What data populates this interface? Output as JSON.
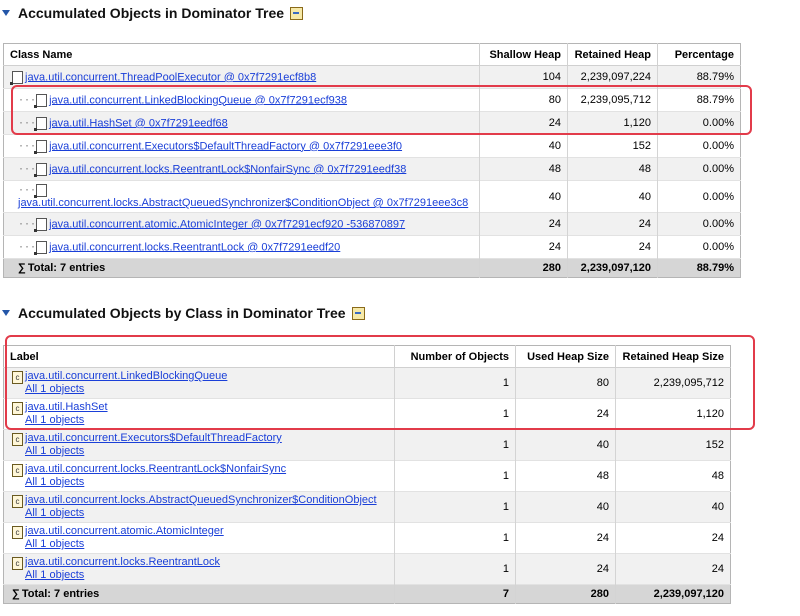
{
  "section1": {
    "title": "Accumulated Objects in Dominator Tree",
    "columns": [
      "Class Name",
      "Shallow Heap",
      "Retained Heap",
      "Percentage"
    ],
    "rows": [
      {
        "tree": "",
        "name": "java.util.concurrent.ThreadPoolExecutor @ 0x7f7291ecf8b8",
        "shallow": "104",
        "retained": "2,239,097,224",
        "pct": "88.79%"
      },
      {
        "tree": "···",
        "name": "java.util.concurrent.LinkedBlockingQueue @ 0x7f7291ecf938",
        "shallow": "80",
        "retained": "2,239,095,712",
        "pct": "88.79%"
      },
      {
        "tree": "···",
        "name": "java.util.HashSet @ 0x7f7291eedf68",
        "shallow": "24",
        "retained": "1,120",
        "pct": "0.00%"
      },
      {
        "tree": "···",
        "name": "java.util.concurrent.Executors$DefaultThreadFactory @ 0x7f7291eee3f0",
        "shallow": "40",
        "retained": "152",
        "pct": "0.00%"
      },
      {
        "tree": "···",
        "name": "java.util.concurrent.locks.ReentrantLock$NonfairSync @ 0x7f7291eedf38",
        "shallow": "48",
        "retained": "48",
        "pct": "0.00%"
      },
      {
        "tree": "···",
        "name": "java.util.concurrent.locks.AbstractQueuedSynchronizer$ConditionObject @ 0x7f7291eee3c8",
        "shallow": "40",
        "retained": "40",
        "pct": "0.00%"
      },
      {
        "tree": "···",
        "name": "java.util.concurrent.atomic.AtomicInteger @ 0x7f7291ecf920 -536870897",
        "shallow": "24",
        "retained": "24",
        "pct": "0.00%"
      },
      {
        "tree": "···",
        "name": "java.util.concurrent.locks.ReentrantLock @ 0x7f7291eedf20",
        "shallow": "24",
        "retained": "24",
        "pct": "0.00%"
      }
    ],
    "total": {
      "label": "Total: 7 entries",
      "shallow": "280",
      "retained": "2,239,097,120",
      "pct": "88.79%"
    }
  },
  "section2": {
    "title": "Accumulated Objects by Class in Dominator Tree",
    "columns": [
      "Label",
      "Number of Objects",
      "Used Heap Size",
      "Retained Heap Size"
    ],
    "rows": [
      {
        "name": "java.util.concurrent.LinkedBlockingQueue",
        "sub": "All 1 objects",
        "count": "1",
        "used": "80",
        "retained": "2,239,095,712"
      },
      {
        "name": "java.util.HashSet",
        "sub": "All 1 objects",
        "count": "1",
        "used": "24",
        "retained": "1,120"
      },
      {
        "name": "java.util.concurrent.Executors$DefaultThreadFactory",
        "sub": "All 1 objects",
        "count": "1",
        "used": "40",
        "retained": "152"
      },
      {
        "name": "java.util.concurrent.locks.ReentrantLock$NonfairSync",
        "sub": "All 1 objects",
        "count": "1",
        "used": "48",
        "retained": "48"
      },
      {
        "name": "java.util.concurrent.locks.AbstractQueuedSynchronizer$ConditionObject",
        "sub": "All 1 objects",
        "count": "1",
        "used": "40",
        "retained": "40"
      },
      {
        "name": "java.util.concurrent.atomic.AtomicInteger",
        "sub": "All 1 objects",
        "count": "1",
        "used": "24",
        "retained": "24"
      },
      {
        "name": "java.util.concurrent.locks.ReentrantLock",
        "sub": "All 1 objects",
        "count": "1",
        "used": "24",
        "retained": "24"
      }
    ],
    "total": {
      "label": "Total: 7 entries",
      "count": "7",
      "used": "280",
      "retained": "2,239,097,120"
    }
  },
  "icons": {
    "collapse": "collapse-triangle-icon",
    "export": "export-icon",
    "object": "object-instance-icon",
    "class": "class-icon",
    "sum": "sum-icon"
  },
  "colors": {
    "link": "#1a3fd8",
    "highlight": "#e23b4a",
    "total_row": "#d6d6d6"
  }
}
